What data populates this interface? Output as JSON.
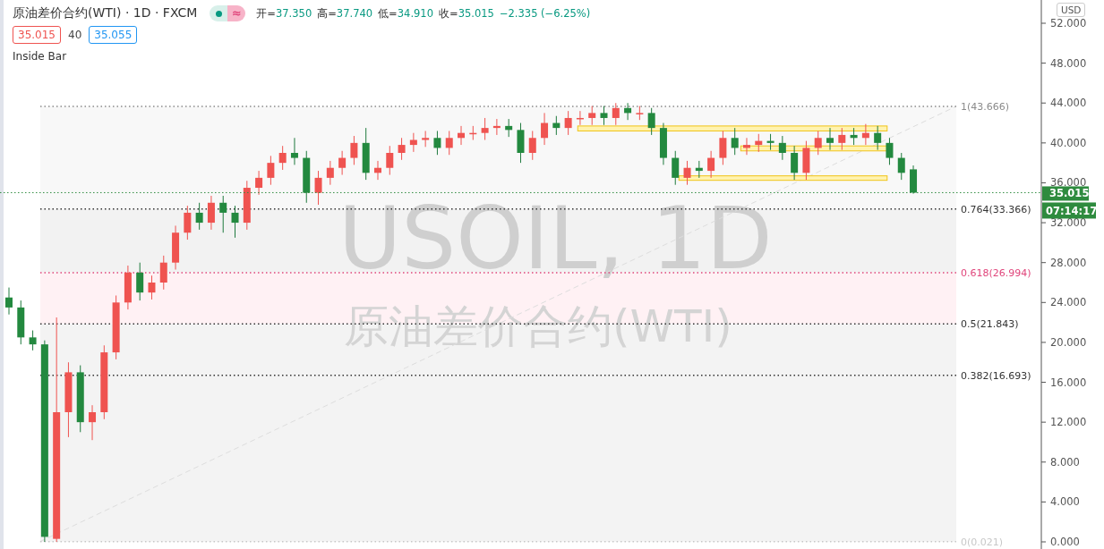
{
  "legend": {
    "symbol": "原油差价合约(WTI) · 1D · FXCM",
    "status_icon": "≈",
    "ohlc": [
      {
        "label": "开=",
        "value": "37.350"
      },
      {
        "label": "高=",
        "value": "37.740"
      },
      {
        "label": "低=",
        "value": "34.910"
      },
      {
        "label": "收=",
        "value": "35.015"
      }
    ],
    "change": "−2.335 (−6.25%)"
  },
  "quote": {
    "bid": "35.015",
    "spread": "40",
    "ask": "35.055"
  },
  "indicator": "Inside Bar",
  "currency_button": "USD",
  "chart": {
    "watermark": [
      "USOIL, 1D",
      "原油差价合约(WTI)"
    ],
    "price_tag": "35.015",
    "countdown": "07:14:17",
    "price_axis": [
      "52.000",
      "48.000",
      "44.000",
      "40.000",
      "36.000",
      "32.000",
      "28.000",
      "24.000",
      "20.000",
      "16.000",
      "12.000",
      "8.000",
      "4.000",
      "0.000"
    ],
    "fib_levels": [
      {
        "label": "1(43.666)",
        "color": "#8a8a8a"
      },
      {
        "label": "0.764(33.366)",
        "color": "#333333"
      },
      {
        "label": "0.618(26.994)",
        "color": "#e0457b"
      },
      {
        "label": "0.5(21.843)",
        "color": "#333333"
      },
      {
        "label": "0.382(16.693)",
        "color": "#333333"
      },
      {
        "label": "0(0.021)",
        "color": "#c8c8c8"
      }
    ]
  }
}
